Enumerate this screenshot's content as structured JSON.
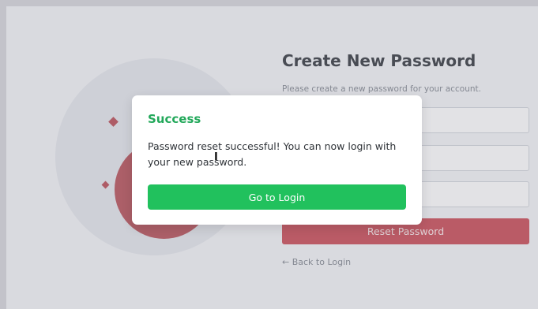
{
  "background_form": {
    "title": "Create New Password",
    "subtitle": "Please create a new password for your account.",
    "reset_button_label": "Reset Password",
    "back_link_label": "← Back to Login"
  },
  "dialog": {
    "title": "Success",
    "message": "Password reset successful! You can now login with your new password.",
    "button_label": "Go to Login"
  },
  "colors": {
    "success_green": "#21c15d",
    "title_green": "#22a85a",
    "accent_red": "#c8454f"
  },
  "icons": {
    "cursor": "text-cursor-icon",
    "cursor_glyph": "I"
  }
}
